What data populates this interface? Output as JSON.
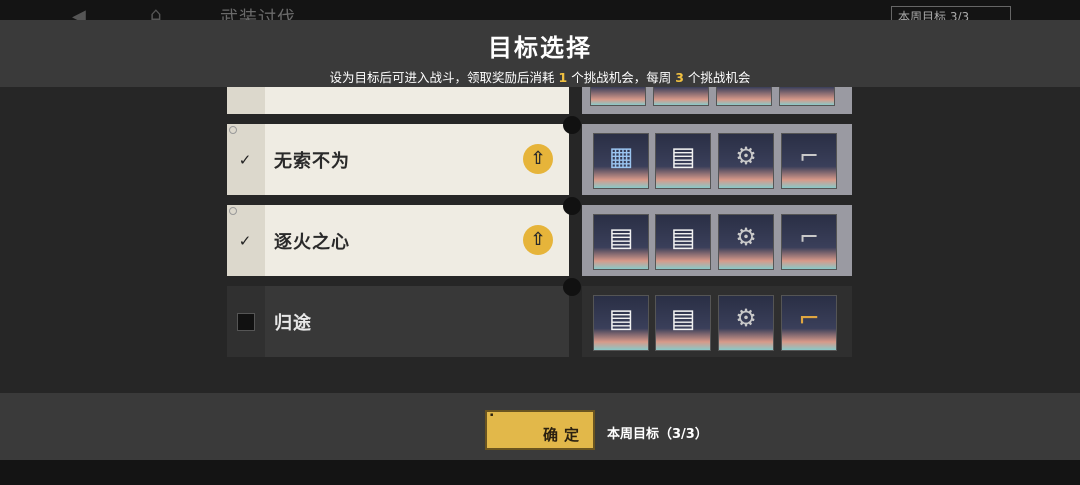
{
  "background": {
    "page_title": "武装讨伐",
    "weekly_badge": "本周目标 3/3"
  },
  "modal": {
    "title": "目标选择",
    "subtitle_a": "设为目标后可进入战斗，领取奖励后消耗",
    "subtitle_cost": "1",
    "subtitle_b": "个挑战机会，每周",
    "subtitle_limit": "3",
    "subtitle_c": "个挑战机会"
  },
  "targets": [
    {
      "name": "无索不为",
      "checked": true,
      "upgrade_icon": "upgrade-icon",
      "rewards": [
        "blueprint-book-icon",
        "blueprint-book-icon",
        "weapon-part-icon",
        "rifle-icon"
      ]
    },
    {
      "name": "逐火之心",
      "checked": true,
      "upgrade_icon": "upgrade-icon",
      "rewards": [
        "blueprint-book-icon",
        "blueprint-book-icon",
        "weapon-part-icon",
        "rifle-icon"
      ]
    },
    {
      "name": "归途",
      "checked": false,
      "rewards": [
        "blueprint-book-icon",
        "blueprint-book-icon",
        "mech-part-icon",
        "rifle-icon"
      ]
    }
  ],
  "footer": {
    "confirm_label": "确定",
    "weekly_label": "本周目标（3/3）"
  },
  "colors": {
    "accent": "#e2b84a",
    "highlight": "#f0c040",
    "selected_row": "#efece3",
    "unselected_row": "#383838"
  }
}
